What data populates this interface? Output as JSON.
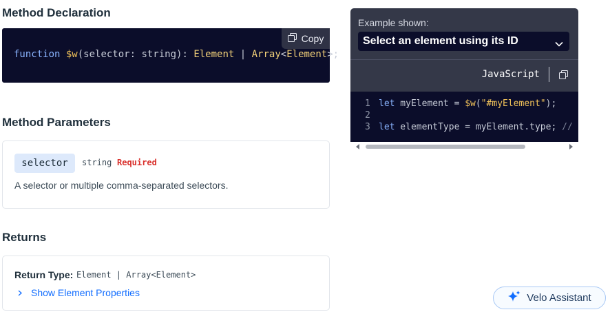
{
  "declaration": {
    "title": "Method Declaration",
    "copy_label": "Copy",
    "tokens": [
      {
        "text": "function",
        "cls": "k-kw"
      },
      {
        "text": " ",
        "cls": "k-pun"
      },
      {
        "text": "$w",
        "cls": "k-fn"
      },
      {
        "text": "(selector: string): ",
        "cls": "k-pun"
      },
      {
        "text": "Element",
        "cls": "k-type"
      },
      {
        "text": " | ",
        "cls": "k-pun"
      },
      {
        "text": "Array",
        "cls": "k-type"
      },
      {
        "text": "<",
        "cls": "k-pun"
      },
      {
        "text": "Element",
        "cls": "k-type"
      },
      {
        "text": ">;",
        "cls": "k-pun"
      }
    ]
  },
  "parameters": {
    "title": "Method Parameters",
    "name": "selector",
    "type": "string",
    "required_label": "Required",
    "description": "A selector or multiple comma-separated selectors."
  },
  "returns": {
    "title": "Returns",
    "type_label": "Return Type:",
    "type_value": "Element | Array<Element>",
    "link_label": "Show Element Properties"
  },
  "example": {
    "label": "Example shown:",
    "selected": "Select an element using its ID",
    "language": "JavaScript",
    "lines": [
      {
        "num": "1",
        "tokens": [
          {
            "text": "let",
            "cls": "c-kw"
          },
          {
            "text": " myElement = ",
            "cls": ""
          },
          {
            "text": "$w",
            "cls": "c-str"
          },
          {
            "text": "(",
            "cls": ""
          },
          {
            "text": "\"#myElement\"",
            "cls": "c-str"
          },
          {
            "text": ");",
            "cls": ""
          }
        ]
      },
      {
        "num": "2",
        "tokens": []
      },
      {
        "num": "3",
        "tokens": [
          {
            "text": "let",
            "cls": "c-kw"
          },
          {
            "text": " elementType = myElement.type; ",
            "cls": ""
          },
          {
            "text": "//",
            "cls": "c-cm"
          }
        ]
      }
    ]
  },
  "assistant": {
    "label": "Velo Assistant"
  },
  "colors": {
    "accent": "#116dff",
    "code_bg": "#0b0d2a",
    "panel_bg": "#343848",
    "required": "#d9302c"
  }
}
